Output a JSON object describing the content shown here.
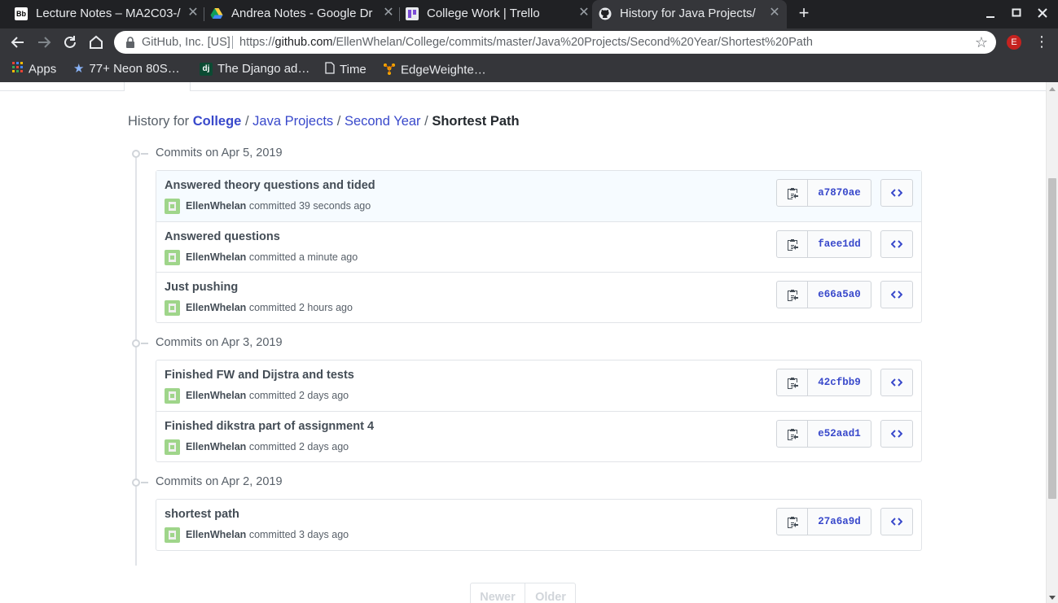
{
  "browser": {
    "tabs": [
      {
        "title": "Lecture Notes – MA2C03-/",
        "favicon": "blackboard-icon",
        "active": false
      },
      {
        "title": "Andrea Notes - Google Dr",
        "favicon": "google-drive-icon",
        "active": false
      },
      {
        "title": "College Work | Trello",
        "favicon": "trello-icon",
        "active": false
      },
      {
        "title": "History for Java Projects/",
        "favicon": "github-icon",
        "active": true
      }
    ],
    "new_tab_glyph": "+",
    "close_glyph": "✕",
    "address": {
      "org": "GitHub, Inc. [US]",
      "url_prefix": "https://",
      "url_host": "github.com",
      "url_path": "/EllenWhelan/College/commits/master/Java%20Projects/Second%20Year/Shortest%20Path"
    },
    "profile_initial": "E",
    "bookmarks": [
      {
        "label": "Apps",
        "icon": "apps-grid-icon"
      },
      {
        "label": "77+ Neon 80S…",
        "icon": "star-icon"
      },
      {
        "label": "The Django ad…",
        "icon": "django-icon"
      },
      {
        "label": "Time",
        "icon": "page-icon"
      },
      {
        "label": "EdgeWeighte…",
        "icon": "tensorflow-icon"
      }
    ]
  },
  "breadcrumb": {
    "prefix": "History for ",
    "repo": "College",
    "sep": " / ",
    "folders": [
      "Java Projects",
      "Second Year"
    ],
    "current": "Shortest Path"
  },
  "commit_groups": [
    {
      "date_label": "Commits on Apr 5, 2019",
      "commits": [
        {
          "message": "Answered theory questions and tided",
          "author": "EllenWhelan",
          "when": "committed 39 seconds ago",
          "sha": "a7870ae"
        },
        {
          "message": "Answered questions",
          "author": "EllenWhelan",
          "when": "committed a minute ago",
          "sha": "faee1dd"
        },
        {
          "message": "Just pushing",
          "author": "EllenWhelan",
          "when": "committed 2 hours ago",
          "sha": "e66a5a0"
        }
      ]
    },
    {
      "date_label": "Commits on Apr 3, 2019",
      "commits": [
        {
          "message": "Finished FW and Dijstra and tests",
          "author": "EllenWhelan",
          "when": "committed 2 days ago",
          "sha": "42cfbb9"
        },
        {
          "message": "Finished dikstra part of assignment 4",
          "author": "EllenWhelan",
          "when": "committed 2 days ago",
          "sha": "e52aad1"
        }
      ]
    },
    {
      "date_label": "Commits on Apr 2, 2019",
      "commits": [
        {
          "message": "shortest path",
          "author": "EllenWhelan",
          "when": "committed 3 days ago",
          "sha": "27a6a9d"
        }
      ]
    }
  ],
  "pagination": {
    "newer": "Newer",
    "older": "Older"
  },
  "colors": {
    "link": "#3949cb",
    "chrome_dark": "#202124",
    "chrome_toolbar": "#35363a"
  }
}
